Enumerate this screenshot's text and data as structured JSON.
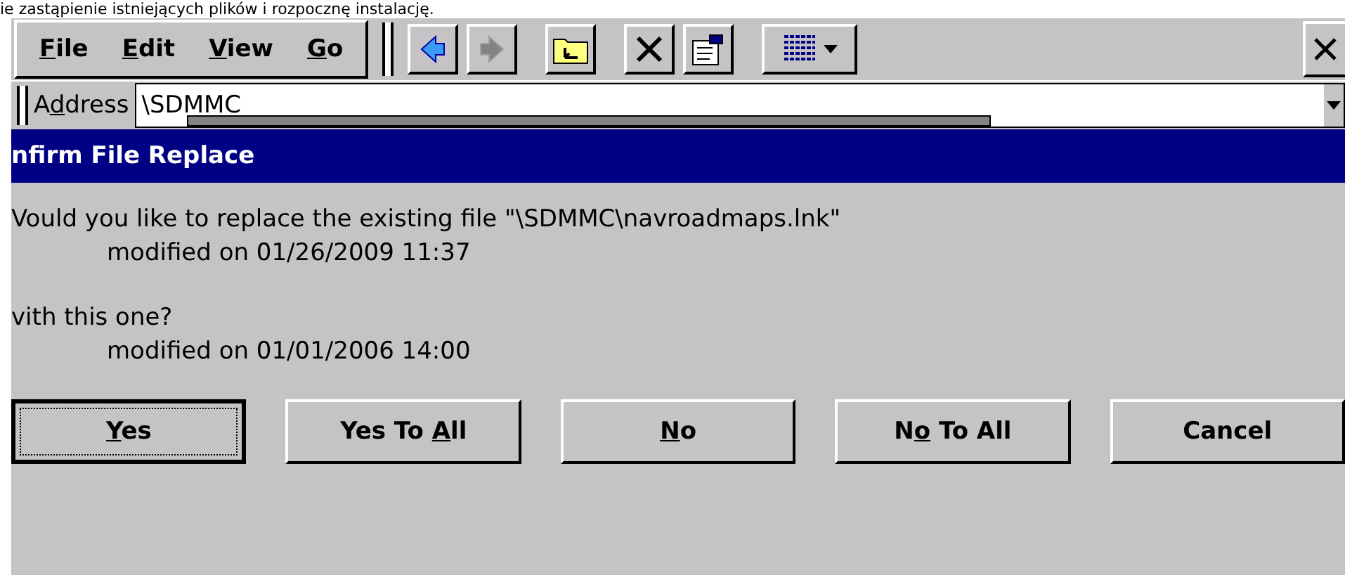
{
  "caption": "ie zastąpienie istniejących plików i rozpocznę instalację.",
  "menu": [
    {
      "mnemonic": "F",
      "rest": "ile"
    },
    {
      "mnemonic": "E",
      "rest": "dit"
    },
    {
      "mnemonic": "V",
      "rest": "iew"
    },
    {
      "mnemonic": "G",
      "rest": "o"
    }
  ],
  "toolbar": [
    {
      "kind": "back",
      "disabled": false
    },
    {
      "kind": "forward",
      "disabled": true
    },
    {
      "kind": "up",
      "disabled": false
    },
    {
      "kind": "delete",
      "disabled": false
    },
    {
      "kind": "properties",
      "disabled": false
    },
    {
      "kind": "views",
      "disabled": false
    }
  ],
  "address": {
    "before": "A",
    "mnemonic": "d",
    "rest": "dress",
    "value": "\\SDMMC"
  },
  "dialog": {
    "title": "nfirm File Replace",
    "lines": [
      {
        "kind": "text",
        "text": "Vould you like to replace the existing file \"\\SDMMC\\navroadmaps.lnk\""
      },
      {
        "kind": "detail",
        "text": "modified on 01/26/2009 11:37"
      },
      {
        "kind": "text",
        "text": "vith this one?"
      },
      {
        "kind": "detail",
        "text": "modified on 01/01/2006 14:00"
      }
    ],
    "buttons": [
      {
        "mnemonic": "Y",
        "rest": "es",
        "selected": true
      },
      {
        "before": "Yes To ",
        "mnemonic": "A",
        "rest": "ll",
        "selected": false
      },
      {
        "mnemonic": "N",
        "rest": "o",
        "selected": false
      },
      {
        "before": "N",
        "mnemonic": "o",
        "rest": " To All",
        "selected": false
      },
      {
        "before": "Cancel",
        "selected": false
      }
    ]
  }
}
